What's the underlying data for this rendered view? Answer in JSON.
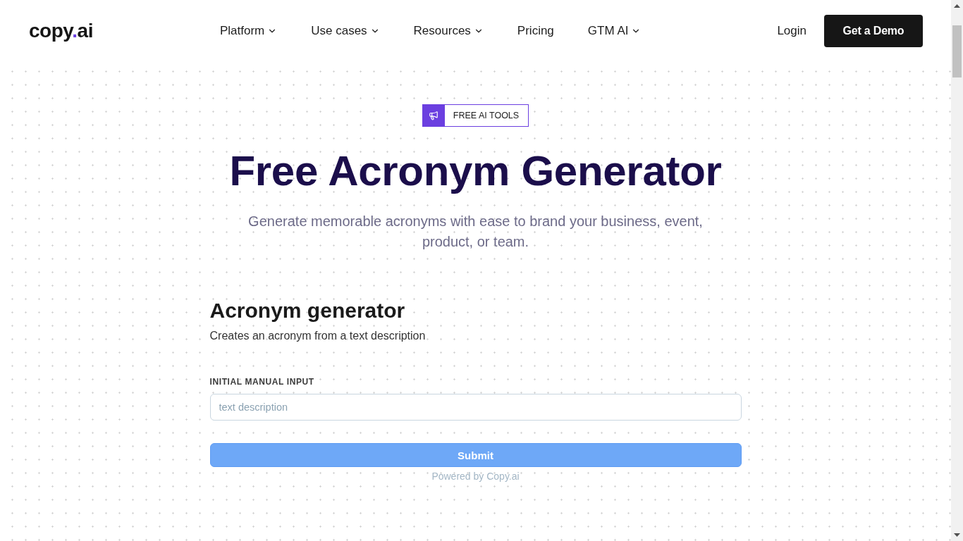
{
  "header": {
    "logo": "copy.ai",
    "nav": [
      {
        "label": "Platform",
        "dropdown": true
      },
      {
        "label": "Use cases",
        "dropdown": true
      },
      {
        "label": "Resources",
        "dropdown": true
      },
      {
        "label": "Pricing",
        "dropdown": false
      },
      {
        "label": "GTM AI",
        "dropdown": true
      }
    ],
    "login": "Login",
    "cta": "Get a Demo"
  },
  "hero": {
    "badge": "FREE AI TOOLS",
    "title": "Free Acronym Generator",
    "subtitle": "Generate memorable acronyms with ease to brand your business, event, product, or team."
  },
  "tool": {
    "title": "Acronym generator",
    "description": "Creates an acronym from a text description",
    "fields": [
      {
        "label": "INITIAL MANUAL INPUT",
        "placeholder": "text description"
      }
    ],
    "submit": "Submit",
    "footer": "Powered by Copy.ai"
  }
}
